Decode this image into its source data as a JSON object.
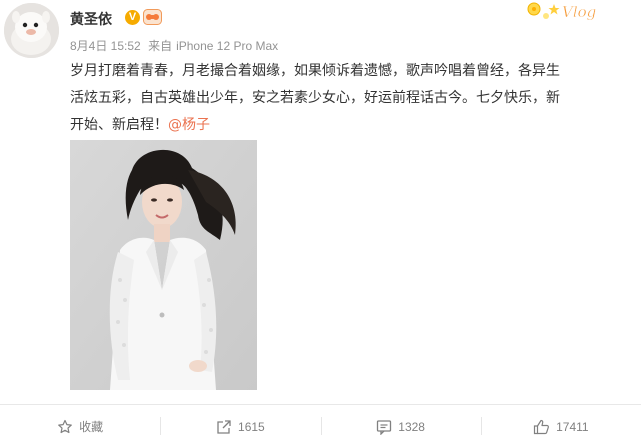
{
  "post": {
    "username": "黄圣依",
    "verified_badge": "V",
    "date": "8月4日 15:52",
    "source_prefix": "来自",
    "source_device": "iPhone 12 Pro Max",
    "text_lines": [
      "岁月打磨着青春，月老撮合着姻缘，如果倾诉着遗憾，歌声吟唱着曾经，各异生",
      "活炫五彩，自古英雄出少年，安之若素少女心，好运前程话古今。七夕快乐，新",
      "开始、新启程！"
    ],
    "mention": "@杨子",
    "decorative_sticker_text": "Vlog"
  },
  "actions": {
    "favorite_label": "收藏",
    "repost_count": "1615",
    "comment_count": "1328",
    "like_count": "17411"
  },
  "colors": {
    "mention": "#eb7350",
    "badge": "#f6ab00",
    "meta_text": "#939393",
    "action_text": "#808080"
  }
}
